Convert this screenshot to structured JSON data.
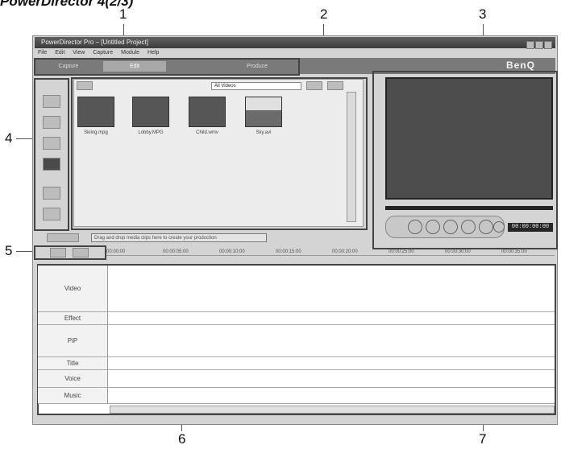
{
  "heading": "PowerDirector 4(2/3)",
  "callouts": {
    "c1": "1",
    "c2": "2",
    "c3": "3",
    "c4": "4",
    "c5": "5",
    "c6": "6",
    "c7": "7"
  },
  "window": {
    "title": "PowerDirector Pro – [Untitled Project]",
    "menu": [
      "File",
      "Edit",
      "View",
      "Capture",
      "Module",
      "Help"
    ]
  },
  "tabs": [
    "Capture",
    "Edit",
    "Produce"
  ],
  "brand": "BenQ",
  "library": {
    "filter_value": "All Videos",
    "thumbnails": [
      {
        "label": "Skiing.mpg"
      },
      {
        "label": "Lobby.MPG"
      },
      {
        "label": "Child.wmv"
      },
      {
        "label": "Sky.avi"
      }
    ]
  },
  "preview": {
    "timecode": "00:00:00:00"
  },
  "status": {
    "text": "Drag and drop media clips here to create your production"
  },
  "ruler": [
    "00:00:00",
    "00:00:05:00",
    "00:00:10:00",
    "00:00:15:00",
    "00:00:20:00",
    "00:00:25:00",
    "00:00:30:00",
    "00:00:35:00"
  ],
  "tracks": [
    "Video",
    "Effect",
    "PiP",
    "Title",
    "Voice",
    "Music"
  ],
  "icons": {
    "library_tools": [
      "video-library-icon",
      "image-library-icon",
      "audio-library-icon",
      "effect-library-icon",
      "pip-object-icon",
      "title-text-icon"
    ],
    "player_controls": [
      "play-icon",
      "stop-icon",
      "previous-frame-icon",
      "next-frame-icon",
      "fast-forward-icon",
      "snapshot-icon"
    ]
  }
}
